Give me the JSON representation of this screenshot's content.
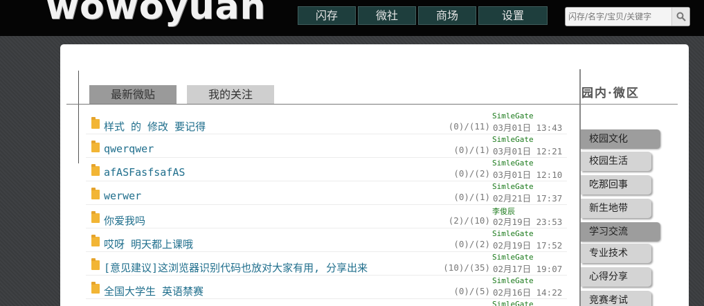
{
  "header": {
    "logo": "wowoyuan",
    "nav": [
      "闪存",
      "微社",
      "商场",
      "设置"
    ],
    "search_placeholder": "闪存/名字/宝贝/关键字"
  },
  "tabs": [
    "最新微贴",
    "我的关注"
  ],
  "sidebar": {
    "title": "园内·微区",
    "groups": [
      {
        "label": "校园文化",
        "items": [
          "校园生活",
          "吃那回事",
          "新生地带"
        ]
      },
      {
        "label": "学习交流",
        "items": [
          "专业技术",
          "心得分享",
          "竞赛考试"
        ]
      }
    ]
  },
  "posts": [
    {
      "title": "样式 的 修改 要记得",
      "count": "(0)/(11)",
      "author": "SimleGate",
      "date": "03月01日 13:43"
    },
    {
      "title": "qwerqwer",
      "count": "(0)/(1)",
      "author": "SimleGate",
      "date": "03月01日 12:21"
    },
    {
      "title": "afASFasfsafAS",
      "count": "(0)/(2)",
      "author": "SimleGate",
      "date": "03月01日 12:10"
    },
    {
      "title": "werwer",
      "count": "(0)/(1)",
      "author": "SimleGate",
      "date": "02月21日 17:37"
    },
    {
      "title": "你爱我吗",
      "count": "(2)/(10)",
      "author": "李俊辰",
      "date": "02月19日 23:53"
    },
    {
      "title": "哎呀 明天都上课哦",
      "count": "(0)/(2)",
      "author": "SimleGate",
      "date": "02月19日 17:52"
    },
    {
      "title": "[意见建议]这浏览器识别代码也放对大家有用, 分享出来",
      "count": "(10)/(35)",
      "author": "SimleGate",
      "date": "02月17日 19:07"
    },
    {
      "title": "全国大学生 英语禁赛",
      "count": "(0)/(5)",
      "author": "SimleGate",
      "date": "02月16日 14:22"
    },
    {
      "title": "",
      "count": "",
      "author": "SimleGate",
      "date": ""
    }
  ]
}
